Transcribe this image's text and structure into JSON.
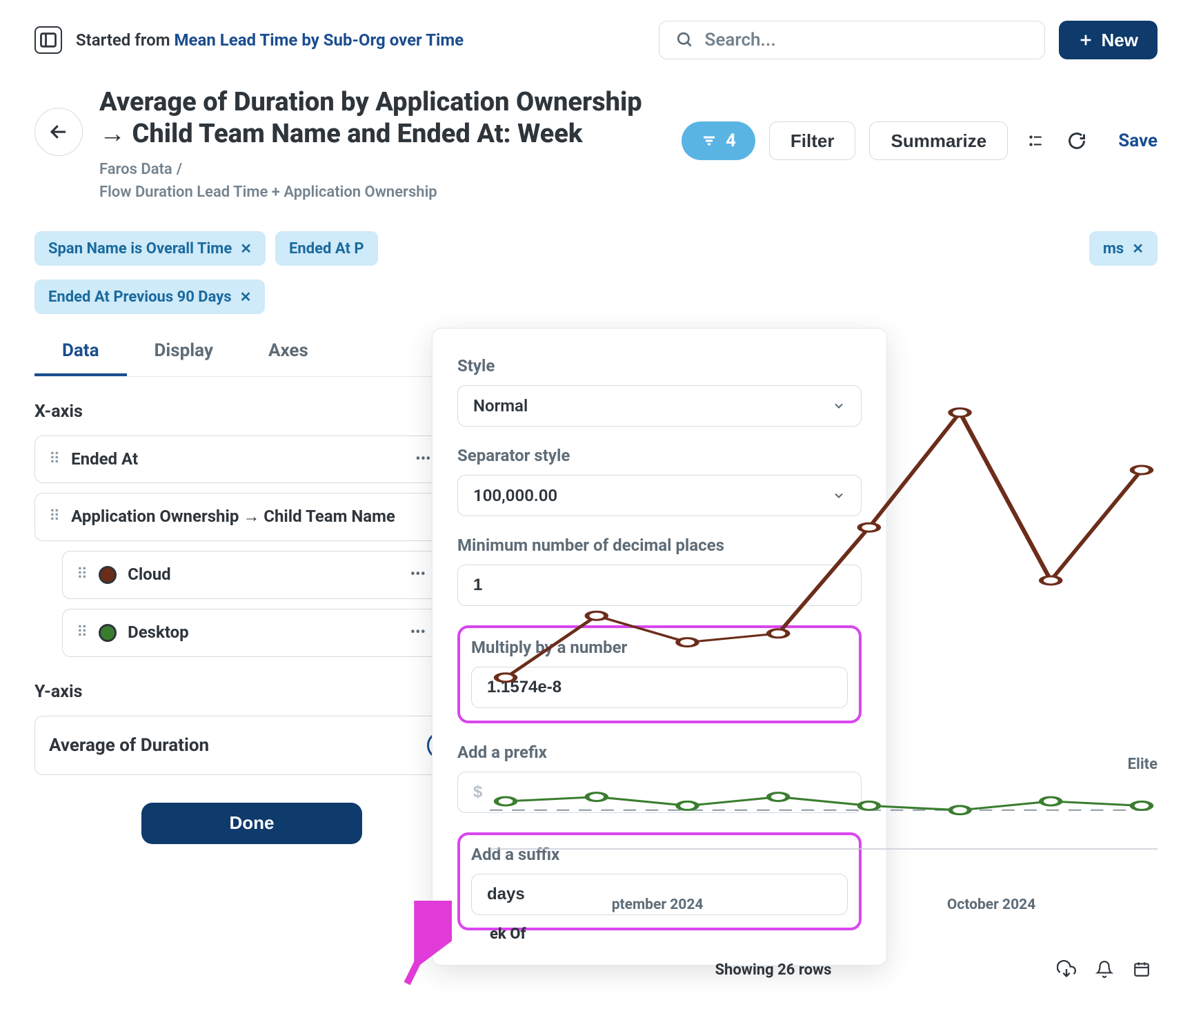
{
  "header": {
    "started_prefix": "Started from ",
    "started_link": "Mean Lead Time by Sub-Org over Time",
    "search_placeholder": "Search...",
    "new_button": "New",
    "title": "Average of Duration by Application Ownership → Child Team Name and Ended At: Week",
    "crumb1": "Faros Data",
    "crumb2": "Flow Duration Lead Time + Application Ownership",
    "filter_count": "4",
    "filter_btn": "Filter",
    "summarize_btn": "Summarize",
    "save_btn": "Save"
  },
  "pills": [
    "Span Name is Overall Time",
    "Ended At P",
    "ms",
    "Ended At Previous 90 Days"
  ],
  "tabs": {
    "data": "Data",
    "display": "Display",
    "axes": "Axes"
  },
  "xaxis": {
    "label": "X-axis",
    "item1": "Ended At",
    "item2": "Application Ownership → Child Team Name",
    "series1": "Cloud",
    "series2": "Desktop"
  },
  "yaxis": {
    "label": "Y-axis",
    "item1": "Average of Duration"
  },
  "done_btn": "Done",
  "popover": {
    "style_label": "Style",
    "style_value": "Normal",
    "separator_label": "Separator style",
    "separator_value": "100,000.00",
    "min_decimals_label": "Minimum number of decimal places",
    "min_decimals_value": "1",
    "multiply_label": "Multiply by a number",
    "multiply_value": "1.1574e-8",
    "prefix_label": "Add a prefix",
    "prefix_placeholder": "$",
    "suffix_label": "Add a suffix",
    "suffix_value": "days"
  },
  "chart_data": {
    "type": "line",
    "xlabel": "ek Of",
    "x_tick_labels": [
      "ptember 2024",
      "October 2024"
    ],
    "ylimit": 100,
    "annotations": {
      "elite_line_y": 8,
      "elite_label": "Elite"
    },
    "series": [
      {
        "name": "Cloud",
        "color": "#6b2d1a",
        "values": [
          38,
          52,
          46,
          48,
          72,
          98,
          60,
          85
        ]
      },
      {
        "name": "Desktop",
        "color": "#3a7d2f",
        "values": [
          10,
          11,
          9,
          11,
          9,
          8,
          10,
          9
        ]
      }
    ],
    "x_count": 8
  },
  "footer": {
    "showing_rows": "Showing 26 rows"
  },
  "colors": {
    "cloud": "#6b2d1a",
    "desktop": "#3a7d2f"
  }
}
